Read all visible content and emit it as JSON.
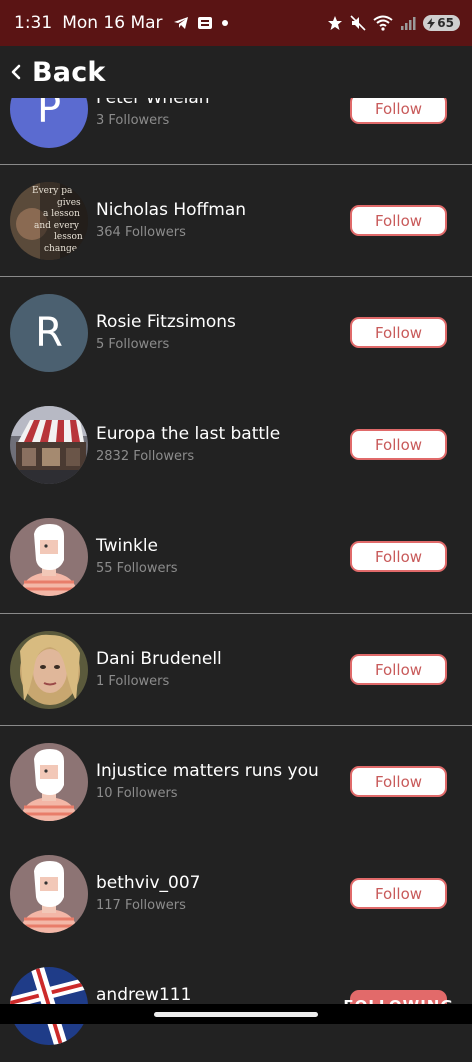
{
  "status": {
    "time": "1:31",
    "date": "Mon 16 Mar",
    "battery": "65"
  },
  "header": {
    "back_label": "Back"
  },
  "users": [
    {
      "name": "Peter Whelan",
      "followers": "3 Followers",
      "button": "Follow",
      "avatar": "letter",
      "letter": "P",
      "color": "#5b6bd0"
    },
    {
      "name": "Nicholas Hoffman",
      "followers": "364 Followers",
      "button": "Follow",
      "avatar": "photo-quote"
    },
    {
      "name": "Rosie Fitzsimons",
      "followers": "5 Followers",
      "button": "Follow",
      "avatar": "letter",
      "letter": "R",
      "color": "#4b6070"
    },
    {
      "name": "Europa the last battle",
      "followers": "2832 Followers",
      "button": "Follow",
      "avatar": "photo-building"
    },
    {
      "name": "Twinkle",
      "followers": "55 Followers",
      "button": "Follow",
      "avatar": "default"
    },
    {
      "name": "Dani Brudenell",
      "followers": "1 Followers",
      "button": "Follow",
      "avatar": "photo-portrait"
    },
    {
      "name": "Injustice matters runs you",
      "followers": "10 Followers",
      "button": "Follow",
      "avatar": "default"
    },
    {
      "name": "bethviv_007",
      "followers": "117 Followers",
      "button": "Follow",
      "avatar": "default"
    },
    {
      "name": "andrew111",
      "followers": "",
      "button": "FOLLOWING",
      "avatar": "photo-flag"
    }
  ],
  "avatar_quote_text": [
    "Every pa",
    "gives",
    "a lesson",
    "and every",
    "lesson",
    "change"
  ],
  "colors": {
    "status_bar": "#5a1414",
    "background": "#222222",
    "follow_border": "#e06a6a",
    "following_fill": "#e26a6a"
  }
}
